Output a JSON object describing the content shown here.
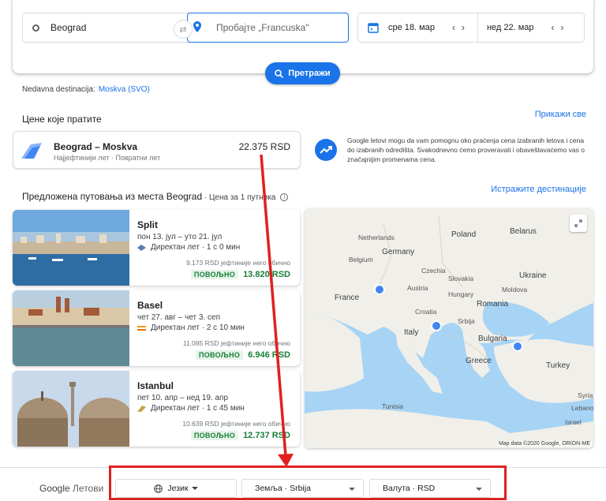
{
  "search": {
    "origin": "Beograd",
    "destination_placeholder": "Пробајте „Francuska\"",
    "depart_date": "сре 18. мар",
    "return_date": "нед 22. мар",
    "search_label": "Претражи"
  },
  "recent": {
    "label": "Nedavna destinacija:",
    "link": "Moskva (SVO)"
  },
  "tracked": {
    "title": "Цене које пратите",
    "show_all": "Прикажи све",
    "route": "Beograd – Moskva",
    "sub": "Најјефтинији лет · Повратни лет",
    "price": "22.375 RSD",
    "info": "Google letovi mogu da vam pomognu oko praćenja cena izabranih letova i cena do izabranih odredišta. Svakodnevno ćemo proveravati i obaveštavaćemo vas o značajnijim promenama cena."
  },
  "suggested": {
    "title": "Предложена путовања из места Beograd",
    "sub": " · Цена за 1 путника",
    "explore": "Истражите дестинације",
    "items": [
      {
        "name": "Split",
        "dates": "пон 13. јул – уто 21. јул",
        "flight": "Директан лет · 1 с 0 мин",
        "cheaper": "9.173 RSD јефтиније него обично",
        "badge": "ПОВОЉНО",
        "price": "13.820 RSD"
      },
      {
        "name": "Basel",
        "dates": "чет 27. авг – чет 3. сеп",
        "flight": "Директан лет · 2 с 10 мин",
        "cheaper": "11.085 RSD јефтиније него обично",
        "badge": "ПОВОЉНО",
        "price": "6.946 RSD"
      },
      {
        "name": "Istanbul",
        "dates": "пет 10. апр – нед 19. апр",
        "flight": "Директан лет · 1 с 45 мин",
        "cheaper": "10.639 RSD јефтиније него обично",
        "badge": "ПОВОЉНО",
        "price": "12.737 RSD"
      }
    ]
  },
  "map": {
    "labels": [
      "Poland",
      "Belarus",
      "Netherlands",
      "Germany",
      "Belgium",
      "Czechia",
      "Slovakia",
      "Ukraine",
      "France",
      "Austria",
      "Hungary",
      "Moldova",
      "Romania",
      "Croatia",
      "Srbija",
      "Italy",
      "Bulgaria",
      "Greece",
      "Turkey",
      "Syria",
      "Tunisia",
      "Lebanon",
      "Israel"
    ],
    "credit": "Map data ©2020 Google, ORION-ME"
  },
  "footer": {
    "brand_google": "Google",
    "brand_product": "Летови",
    "language": "Језик",
    "country": "Земља · Srbija",
    "currency": "Валута · RSD"
  },
  "colors": {
    "accent": "#1a73e8",
    "good": "#188038",
    "highlight": "#e02020"
  }
}
